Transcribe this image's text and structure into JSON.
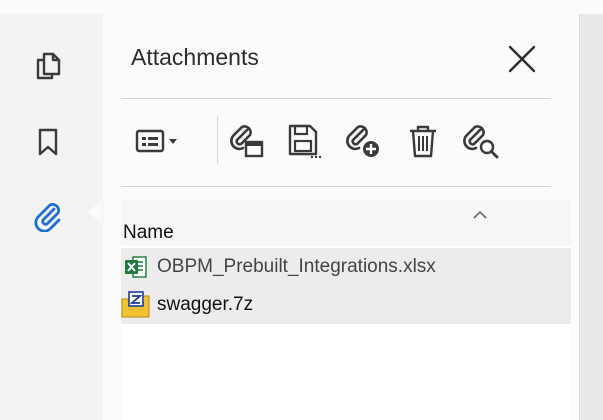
{
  "panel": {
    "title": "Attachments",
    "close_icon": "close-icon"
  },
  "left_rail": {
    "items": [
      {
        "name": "pages-icon"
      },
      {
        "name": "bookmark-icon"
      },
      {
        "name": "attachment-icon",
        "active": true
      }
    ]
  },
  "toolbar": {
    "buttons": [
      {
        "name": "view-options-icon"
      },
      {
        "name": "open-attachment-icon"
      },
      {
        "name": "save-attachment-icon"
      },
      {
        "name": "add-attachment-icon"
      },
      {
        "name": "delete-attachment-icon"
      },
      {
        "name": "search-attachment-icon"
      }
    ]
  },
  "list": {
    "column_name": "Name",
    "rows": [
      {
        "name": "OBPM_Prebuilt_Integrations.xlsx",
        "icon": "excel-file-icon",
        "selected": true
      },
      {
        "name": "swagger.7z",
        "icon": "archive-file-icon",
        "selected": true
      }
    ]
  },
  "colors": {
    "accent": "#1f6fd1",
    "icon_gray": "#3a3a3a",
    "excel_green": "#1d7a3e",
    "archive_yellow": "#f2c233"
  }
}
